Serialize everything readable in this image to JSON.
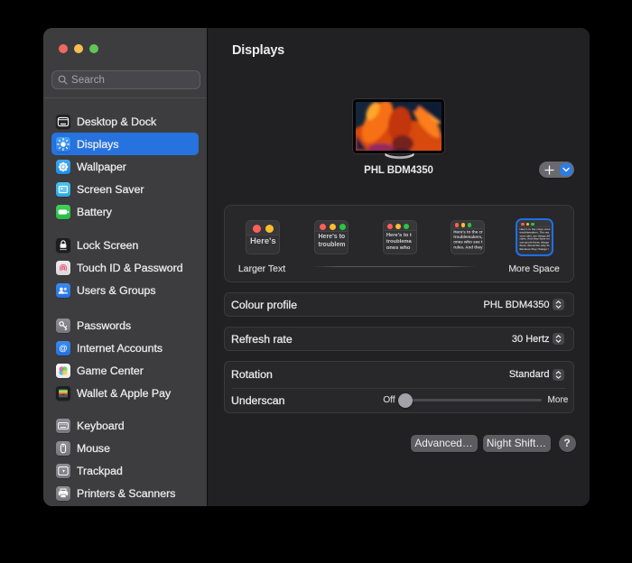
{
  "window": {
    "traffic_lights": {
      "close_color": "#ec6a5e",
      "minimize_color": "#f4bf50",
      "zoom_color": "#61c454"
    }
  },
  "sidebar": {
    "search": {
      "placeholder": "Search"
    },
    "groups": [
      {
        "items": [
          {
            "label": "Desktop & Dock",
            "icon": "desktop-dock-icon"
          },
          {
            "label": "Displays",
            "icon": "displays-icon",
            "selected": true
          },
          {
            "label": "Wallpaper",
            "icon": "wallpaper-icon"
          },
          {
            "label": "Screen Saver",
            "icon": "screen-saver-icon"
          },
          {
            "label": "Battery",
            "icon": "battery-icon"
          }
        ]
      },
      {
        "items": [
          {
            "label": "Lock Screen",
            "icon": "lock-screen-icon"
          },
          {
            "label": "Touch ID & Password",
            "icon": "touch-id-icon"
          },
          {
            "label": "Users & Groups",
            "icon": "users-groups-icon"
          }
        ]
      },
      {
        "items": [
          {
            "label": "Passwords",
            "icon": "passwords-icon"
          },
          {
            "label": "Internet Accounts",
            "icon": "internet-accounts-icon"
          },
          {
            "label": "Game Center",
            "icon": "game-center-icon"
          },
          {
            "label": "Wallet & Apple Pay",
            "icon": "wallet-icon"
          }
        ]
      },
      {
        "items": [
          {
            "label": "Keyboard",
            "icon": "keyboard-icon"
          },
          {
            "label": "Mouse",
            "icon": "mouse-icon"
          },
          {
            "label": "Trackpad",
            "icon": "trackpad-icon"
          },
          {
            "label": "Printers & Scanners",
            "icon": "printers-icon"
          }
        ]
      }
    ]
  },
  "content": {
    "title": "Displays",
    "display": {
      "name": "PHL BDM4350"
    },
    "scaling": {
      "left_label": "Larger Text",
      "right_label": "More Space",
      "selected_index": 4,
      "options": [
        {
          "name": "larger-text",
          "lines": [
            "Here's"
          ]
        },
        {
          "name": "scale-2",
          "lines": [
            "Here's to",
            "troublem"
          ]
        },
        {
          "name": "scale-3",
          "lines": [
            "Here's to t",
            "troublema",
            "ones who"
          ]
        },
        {
          "name": "scale-4",
          "lines": [
            "Here's to the cr",
            "troublemakers,",
            "ones who see t",
            "rules. And they"
          ]
        },
        {
          "name": "more-space",
          "selected": true,
          "lines": [
            "Here's to the crazy ones",
            "troublemakers. The rea",
            "ones who see things dif",
            "rules. And they have no",
            "can quote them, disagr",
            "them. About the only th",
            "Because they change t"
          ]
        }
      ]
    },
    "settings": [
      {
        "label": "Colour profile",
        "value": "PHL BDM4350"
      },
      {
        "label": "Refresh rate",
        "value": "30 Hertz"
      },
      {
        "label": "Rotation",
        "value": "Standard"
      }
    ],
    "underscan": {
      "label": "Underscan",
      "min_label": "Off",
      "max_label": "More",
      "value_percent": 2
    },
    "footer": {
      "advanced": "Advanced…",
      "night_shift": "Night Shift…",
      "help": "?"
    }
  },
  "colors": {
    "accent_blue": "#2673df",
    "selection_ring": "#1e6fe8",
    "sidebar_bg": "#3d3d3f",
    "content_bg": "#212124",
    "card_bg": "#28282b",
    "mini_close": "#ff5f57",
    "mini_minimize": "#febc2e",
    "mini_zoom": "#28c840"
  }
}
